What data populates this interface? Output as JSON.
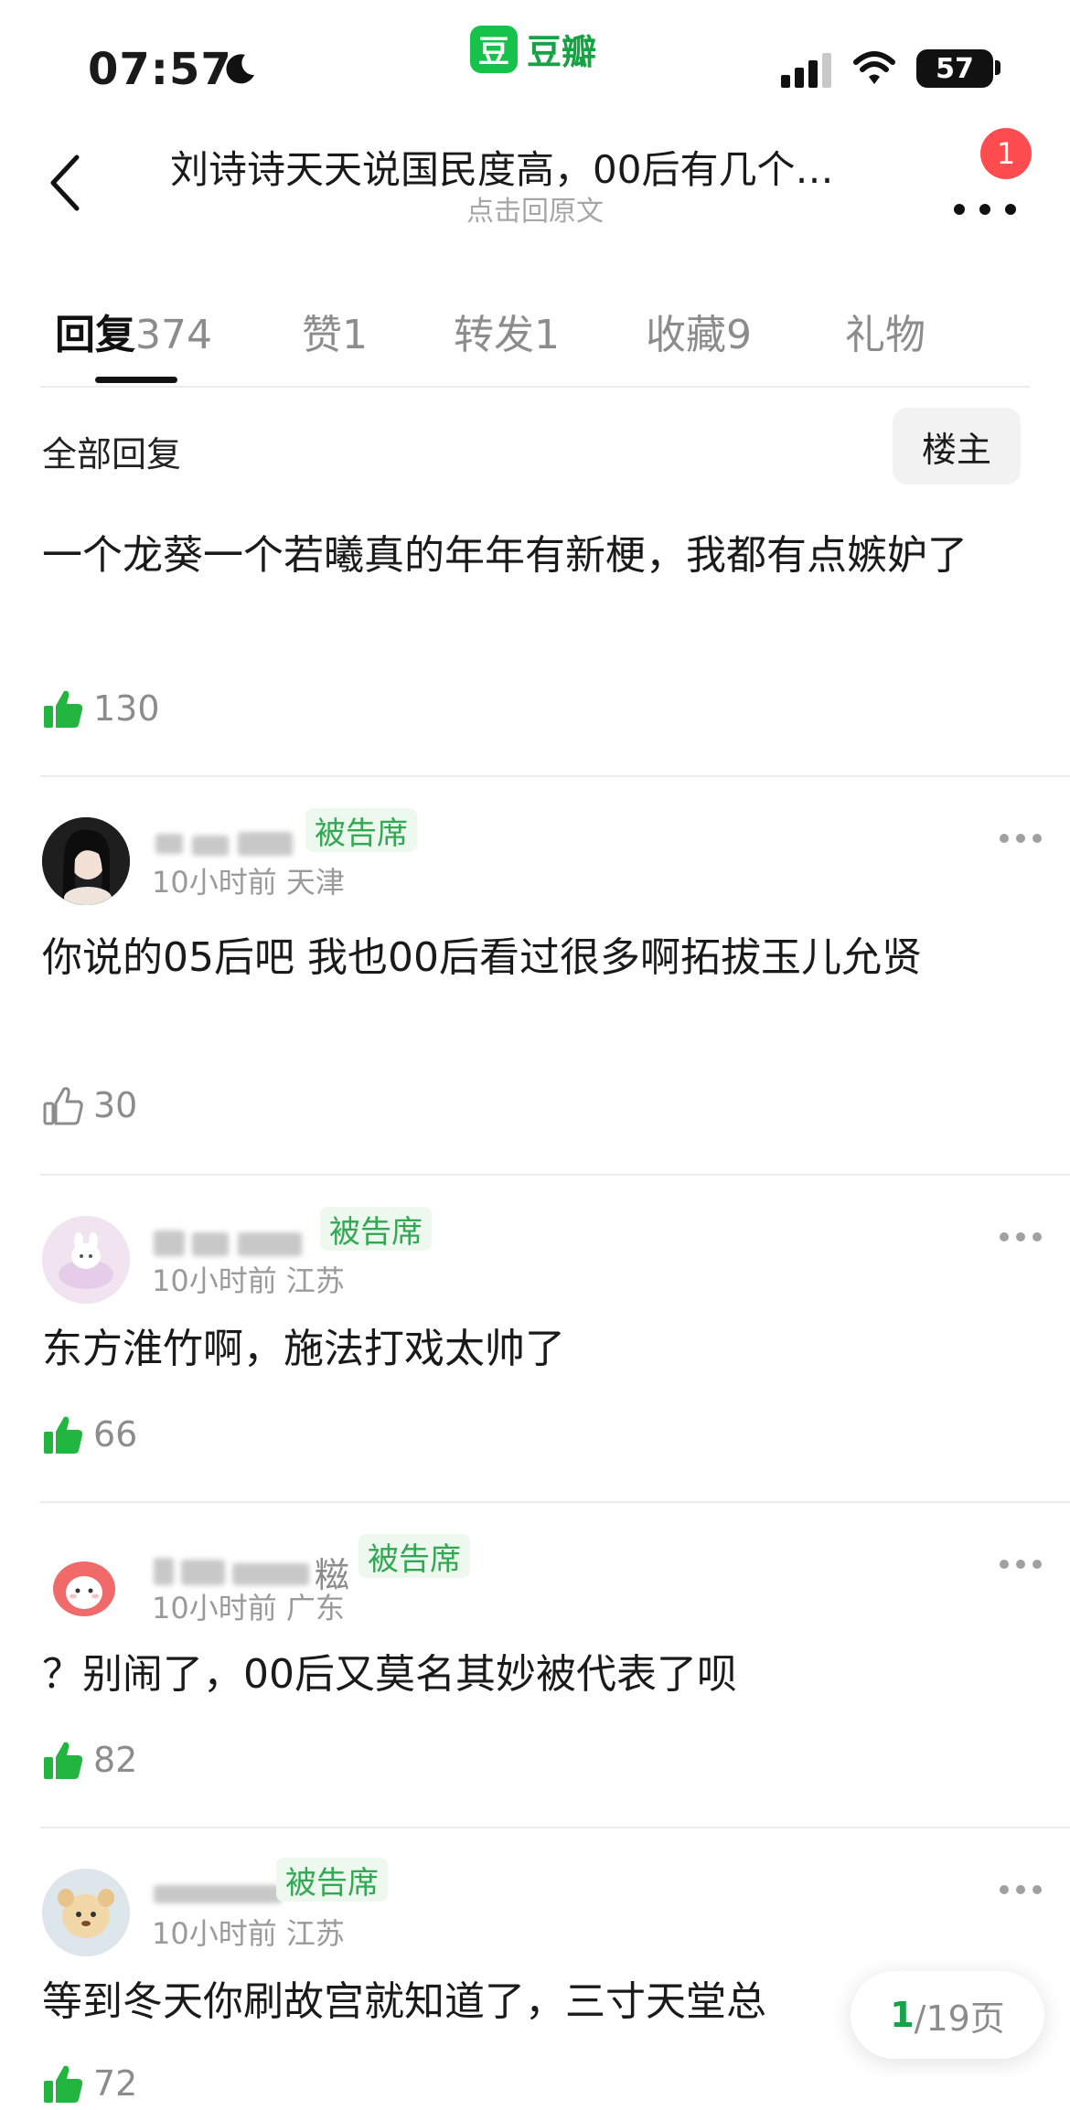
{
  "status_bar": {
    "time": "07:57",
    "app_name": "豆瓣",
    "app_logo_char": "豆",
    "battery": "57",
    "icons": [
      "moon-icon",
      "signal-icon",
      "wifi-icon",
      "battery-icon"
    ]
  },
  "header": {
    "title": "刘诗诗天天说国民度高，00后有几个…",
    "subtitle": "点击回原文",
    "notification_count": "1"
  },
  "tabs": [
    {
      "label": "回复",
      "count": "374",
      "active": true
    },
    {
      "label": "赞",
      "count": "1"
    },
    {
      "label": "转发",
      "count": "1"
    },
    {
      "label": "收藏",
      "count": "9"
    },
    {
      "label": "礼物",
      "count": ""
    }
  ],
  "filter": {
    "title": "全部回复",
    "op_button": "楼主"
  },
  "comments": [
    {
      "text": "一个龙葵一个若曦真的年年有新梗，我都有点嫉妒了",
      "likes": "130",
      "liked": true
    },
    {
      "tag": "被告席",
      "time": "10小时前",
      "location": "天津",
      "text": "你说的05后吧 我也00后看过很多啊拓拔玉儿允贤",
      "likes": "30",
      "liked": false
    },
    {
      "tag": "被告席",
      "time": "10小时前",
      "location": "江苏",
      "text": "东方淮竹啊，施法打戏太帅了",
      "likes": "66",
      "liked": true
    },
    {
      "name_visible_char": "糍",
      "tag": "被告席",
      "time": "10小时前",
      "location": "广东",
      "text": "？别闹了，00后又莫名其妙被代表了呗",
      "likes": "82",
      "liked": true
    },
    {
      "tag": "被告席",
      "time": "10小时前",
      "location": "江苏",
      "text": "等到冬天你刷故宫就知道了，三寸天堂总",
      "likes": "72",
      "liked": true
    }
  ],
  "pagination": {
    "current": "1",
    "total_text": "/19页"
  },
  "colors": {
    "accent_green": "#16c24a",
    "tag_green": "#33a853",
    "tag_bg": "#edf8ee",
    "badge_red": "#ff4d4f"
  }
}
